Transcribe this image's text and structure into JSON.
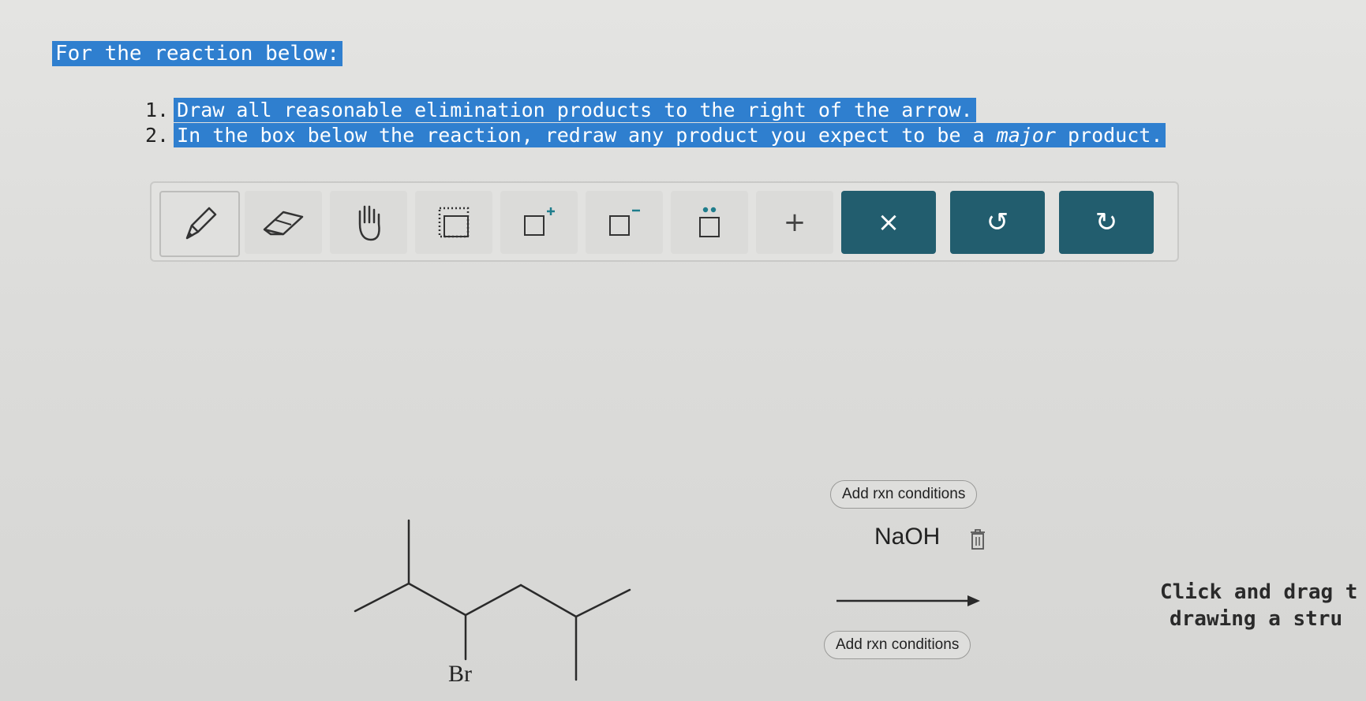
{
  "prompt": {
    "title": "For the reaction below:",
    "steps": [
      {
        "number": "1.",
        "text": "Draw all reasonable elimination products to the right of the arrow."
      },
      {
        "number": "2.",
        "text_before": "In the box below the reaction, redraw any product you expect to be a ",
        "emphasis": "major",
        "text_after": " product."
      }
    ]
  },
  "toolbar": {
    "tools": [
      {
        "name": "pencil-tool",
        "icon": "pencil-icon",
        "active": true
      },
      {
        "name": "eraser-tool",
        "icon": "eraser-icon"
      },
      {
        "name": "hand-tool",
        "icon": "hand-icon"
      },
      {
        "name": "select-tool",
        "icon": "dotted-box-icon"
      },
      {
        "name": "positive-charge-tool",
        "icon": "box-plus-icon"
      },
      {
        "name": "negative-charge-tool",
        "icon": "box-minus-icon"
      },
      {
        "name": "lone-pair-tool",
        "icon": "box-dots-icon"
      },
      {
        "name": "add-tool",
        "icon": "plus-icon",
        "glyph": "+"
      },
      {
        "name": "clear-button",
        "icon": "x-icon",
        "glyph": "×"
      },
      {
        "name": "undo-button",
        "icon": "undo-icon",
        "glyph": "↺"
      },
      {
        "name": "redo-button",
        "icon": "redo-icon",
        "glyph": "↻"
      }
    ]
  },
  "reaction": {
    "add_conditions_top": "Add rxn conditions",
    "reagent": "NaOH",
    "add_conditions_bottom": "Add rxn conditions",
    "substituent_label": "Br"
  },
  "hint": {
    "line1": "Click and drag t",
    "line2": "drawing a stru"
  },
  "colors": {
    "selection": "#2f7fcf",
    "dark_button": "#225d6e"
  }
}
